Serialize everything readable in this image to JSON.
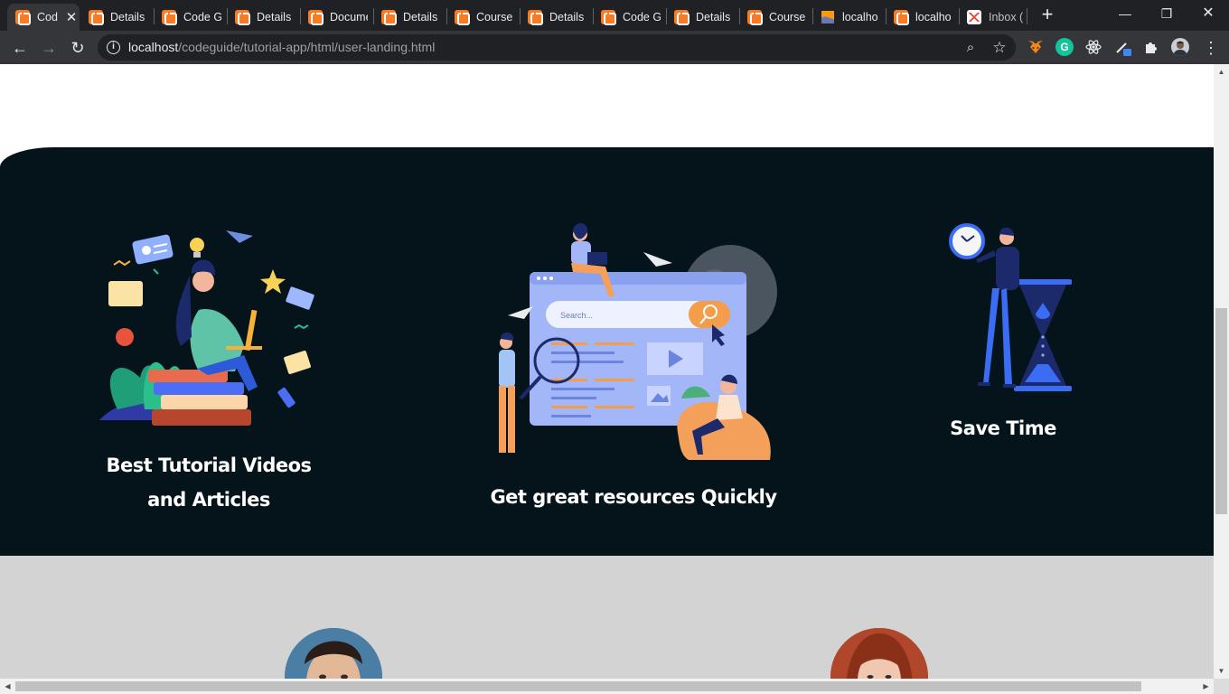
{
  "browser": {
    "tabs": [
      {
        "title": "Cod",
        "icon": "xampp-icon",
        "active": true
      },
      {
        "title": "Details",
        "icon": "xampp-icon"
      },
      {
        "title": "Code G",
        "icon": "xampp-icon"
      },
      {
        "title": "Details",
        "icon": "xampp-icon"
      },
      {
        "title": "Docume",
        "icon": "xampp-icon"
      },
      {
        "title": "Details",
        "icon": "xampp-icon"
      },
      {
        "title": "Course",
        "icon": "xampp-icon"
      },
      {
        "title": "Details",
        "icon": "xampp-icon"
      },
      {
        "title": "Code G",
        "icon": "xampp-icon"
      },
      {
        "title": "Details",
        "icon": "xampp-icon"
      },
      {
        "title": "Course",
        "icon": "xampp-icon"
      },
      {
        "title": "localho",
        "icon": "phpmyadmin-icon"
      },
      {
        "title": "localho",
        "icon": "xampp-icon"
      },
      {
        "title": "Inbox (",
        "icon": "gmail-icon"
      }
    ],
    "url_host": "localhost",
    "url_path": "/codeguide/tutorial-app/html/user-landing.html",
    "controls": {
      "close_tab": "✕",
      "new_tab": "+",
      "minimize": "—",
      "restore": "❐",
      "close_window": "✕",
      "back": "←",
      "forward": "→",
      "reload": "↻",
      "info": "i",
      "zoom": "⌕",
      "bookmark": "☆",
      "more": "⋮"
    },
    "extensions": [
      "metamask-icon",
      "grammarly-icon",
      "react-devtools-icon",
      "color-picker-icon",
      "extensions-puzzle-icon",
      "profile-avatar"
    ],
    "grammarly_letter": "G"
  },
  "page": {
    "features": [
      {
        "title_line1": "Best Tutorial Videos",
        "title_line2": "and Articles",
        "illustration": "student-laptop-books-illustration"
      },
      {
        "title_line1": "Get great resources Quickly",
        "title_line2": "",
        "illustration": "search-resources-illustration",
        "search_placeholder": "Search..."
      },
      {
        "title_line1": "Save Time",
        "title_line2": "",
        "illustration": "hourglass-clock-illustration"
      }
    ],
    "testimonials": [
      {
        "avatar": "man-avatar"
      },
      {
        "avatar": "woman-avatar"
      }
    ]
  },
  "colors": {
    "dark_section": "#05141a",
    "grey_section": "#d3d3d3",
    "accent_orange": "#f5a05a",
    "accent_blue": "#8fa8f5"
  }
}
